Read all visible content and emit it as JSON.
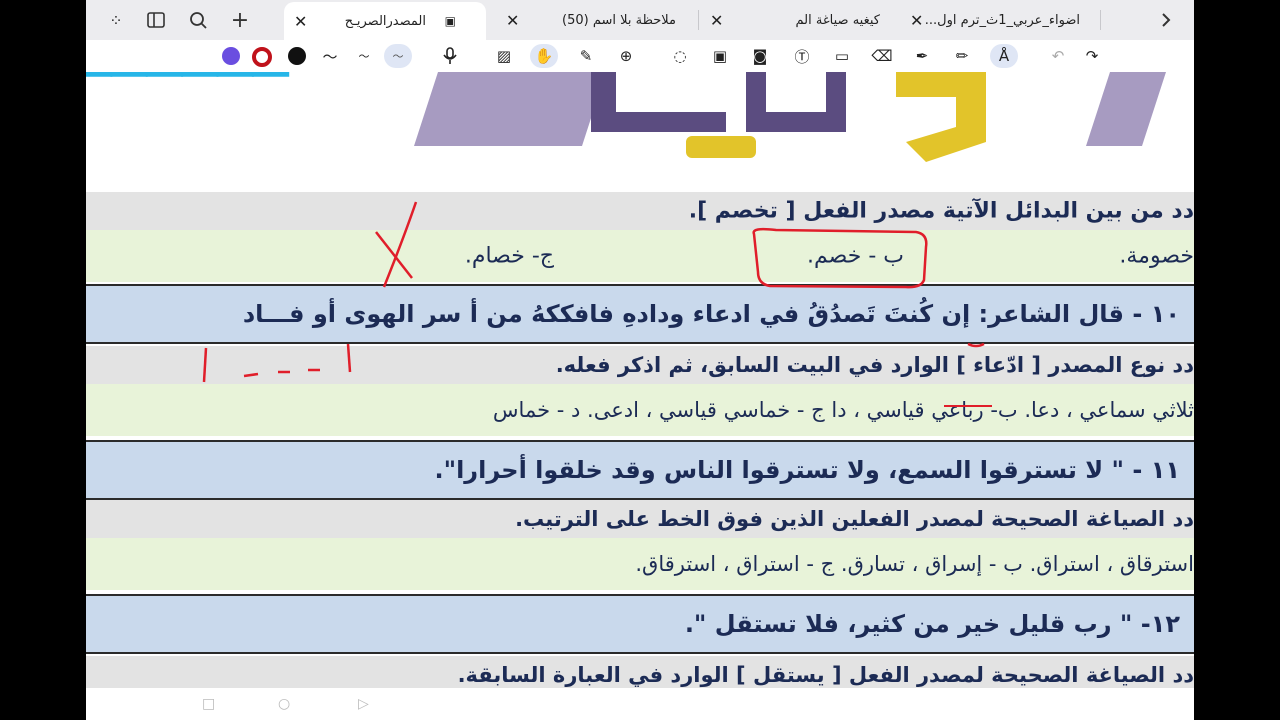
{
  "tabs": [
    {
      "title": "المصدرالصريـح",
      "active": true
    },
    {
      "title": "ملاحظة بلا اسم (50)",
      "active": false
    },
    {
      "title": "كيغيه صياغة الم",
      "active": false
    },
    {
      "title": "اضواء_عربي_1ث_ترم اول...",
      "active": false
    }
  ],
  "colors": {
    "purple": "#6a4ee0",
    "red": "#c0121b",
    "black": "#111111",
    "ink_red": "#e01e2a",
    "text_navy": "#1c2b55"
  },
  "doc": {
    "q9_instruction": "دد من بين البدائل الآتية مصدر الفعل [ تخصم ].",
    "q9_opt_a": "خصومة.",
    "q9_opt_b": "ب - خصم.",
    "q9_opt_c": "ج- خصام.",
    "q10_title": "١٠ - قال الشاعر: إن كُنتَ تَصدُقُ في ادعاء ودادهِ      فافككهُ من أ سر الهوى أو فـــاد",
    "q10_instruction": "دد نوع المصدر [ ادّعاء ] الوارد في البيت السابق، ثم اذكر فعله.",
    "q10_options": "ثلاثي سماعي ، دعا.      ب- رباعي قياسي ، دا           ج - خماسي قياسي ، ادعى.          د - خماس",
    "q11_title": "١١ - \" لا تسترقوا السمع، ولا تسترقوا الناس وقد خلقوا أحرارا\".",
    "q11_instruction": "دد الصياغة الصحيحة لمصدر الفعلين الذين فوق الخط على الترتيب.",
    "q11_options": "استرقاق ، استراق.          ب - إسراق ، تسارق.           ج - استراق ، استرقاق.",
    "q12_title": "١٢- \" رب قليل خير من كثير، فلا تستقل \".",
    "q12_instruction": "دد الصياغة الصحيحة لمصدر الفعل [ يستقل ] الوارد في العبارة السابقة."
  }
}
